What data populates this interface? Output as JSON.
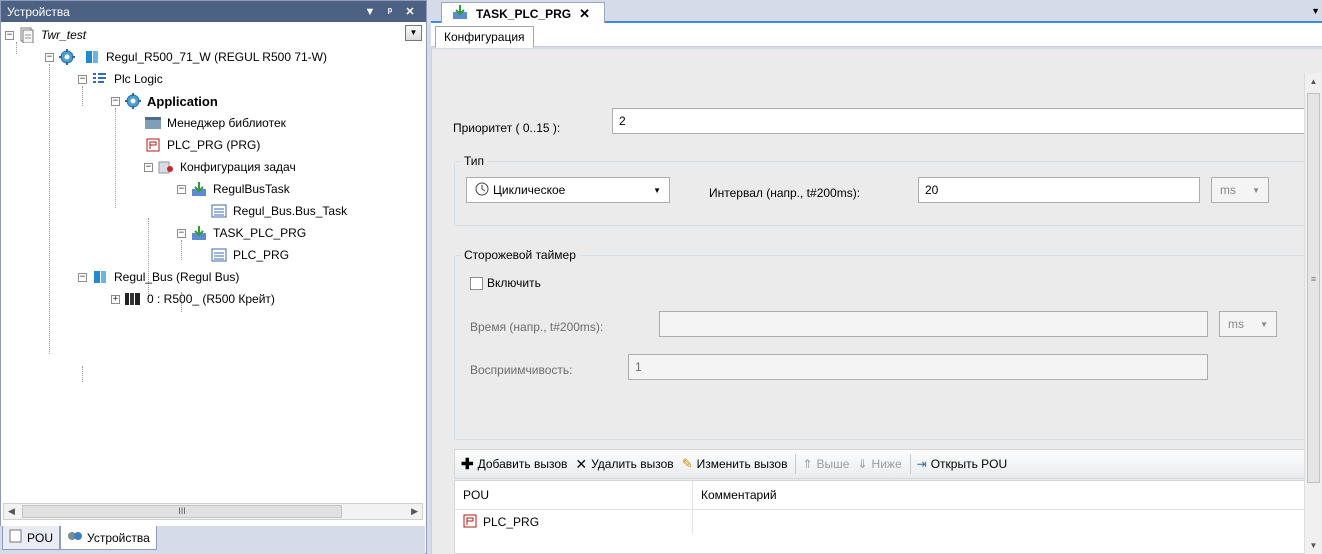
{
  "devices": {
    "title": "Устройства",
    "tree": [
      {
        "label": "Twr_test"
      },
      {
        "label": "Regul_R500_71_W (REGUL R500 71-W)"
      },
      {
        "label": "Plc Logic"
      },
      {
        "label": "Application"
      },
      {
        "label": "Менеджер библиотек"
      },
      {
        "label": "PLC_PRG (PRG)"
      },
      {
        "label": "Конфигурация задач"
      },
      {
        "label": "RegulBusTask"
      },
      {
        "label": "Regul_Bus.Bus_Task"
      },
      {
        "label": "TASK_PLC_PRG"
      },
      {
        "label": "PLC_PRG"
      },
      {
        "label": "Regul_Bus (Regul Bus)"
      },
      {
        "label": "0 : R500_ (R500 Крейт)"
      }
    ],
    "scroll_grip": "III",
    "bottom_tabs": [
      "POU",
      "Устройства"
    ]
  },
  "editor": {
    "doc_tab": "TASK_PLC_PRG",
    "config_tab": "Конфигурация",
    "priority_label": "Приоритет ( 0..15 ):",
    "priority_value": "2",
    "type_group": "Тип",
    "type_value": "Циклическое",
    "interval_label": "Интервал (напр., t#200ms):",
    "interval_value": "20",
    "interval_unit": "ms",
    "watchdog_group": "Сторожевой таймер",
    "watchdog_enable": "Включить",
    "watchdog_enabled": false,
    "time_label": "Время (напр., t#200ms):",
    "time_value": "",
    "time_unit": "ms",
    "sensitivity_label": "Восприимчивость:",
    "sensitivity_value": "1",
    "toolbar": {
      "add": "Добавить вызов",
      "delete": "Удалить вызов",
      "edit": "Изменить вызов",
      "up": "Выше",
      "down": "Ниже",
      "open": "Открыть POU"
    },
    "table": {
      "columns": [
        "POU",
        "Комментарий"
      ],
      "rows": [
        [
          "PLC_PRG",
          ""
        ]
      ]
    }
  },
  "colors": {
    "title_bar": "#4d6185",
    "accent": "#3c8be6",
    "task_icon": "#2f9c3a"
  }
}
